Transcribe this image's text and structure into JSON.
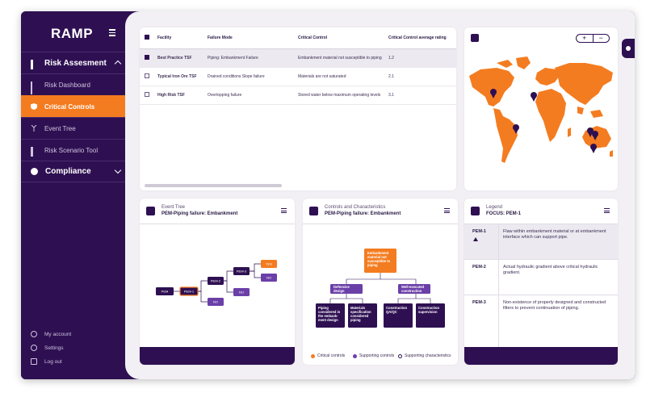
{
  "app": {
    "logo": "RAMP"
  },
  "sidebar": {
    "groups": [
      {
        "label": "Risk Assesment"
      },
      {
        "label": "Compliance"
      }
    ],
    "items": [
      {
        "label": "Risk Dashboard"
      },
      {
        "label": "Critical Controls"
      },
      {
        "label": "Event Tree"
      },
      {
        "label": "Risk Scenario Tool"
      }
    ],
    "footer": [
      {
        "label": "My account"
      },
      {
        "label": "Settings"
      },
      {
        "label": "Log out"
      }
    ]
  },
  "table": {
    "headers": [
      "Facility",
      "Failure Mode",
      "Critical Control",
      "Critical Control average rating"
    ],
    "rows": [
      {
        "facility": "Best Practice TSF",
        "mode": "Piping: Embankment Failure",
        "control": "Embankment material not susceptible to piping",
        "rating": "1.2",
        "checked": true
      },
      {
        "facility": "Typical Iron Ore TSF",
        "mode": "Drained conditions Slope failure",
        "control": "Materials are not saturated",
        "rating": "2.1",
        "checked": false
      },
      {
        "facility": "High Risk TSF",
        "mode": "Overtopping failure",
        "control": "Stored water below maximum operating levels",
        "rating": "3.1",
        "checked": false
      }
    ]
  },
  "map": {
    "zoom_in": "+",
    "zoom_out": "−",
    "land_color": "#f47c20",
    "pin_color": "#2e1052"
  },
  "event_tree": {
    "title": "Event Tree",
    "subtitle": "PEM-Piping failure: Embankment",
    "nodes": {
      "pem": "PEM",
      "pem1": "PEM-1",
      "pem2": "PEM-2",
      "pem3": "PEM-3",
      "pem4": "PEM-4",
      "yes": "YES",
      "no1": "NO",
      "no2": "NO",
      "no3": "NO"
    }
  },
  "controls": {
    "title": "Controls and Characteristics",
    "subtitle": "PEM-Piping failure: Embankment",
    "root": [
      "Embankment",
      "material not",
      "susceptible to",
      "piping"
    ],
    "mid_left": [
      "Defensive",
      "design"
    ],
    "mid_right": [
      "Well-executed",
      "construction"
    ],
    "leaves": [
      [
        "Piping",
        "considered in",
        "the embank-",
        "ment design"
      ],
      [
        "Materials",
        "specification",
        "considered",
        "piping"
      ],
      [
        "Construction",
        "QA/QC"
      ],
      [
        "Construction",
        "supervision"
      ]
    ],
    "keys": [
      "Critical controls",
      "Supporting controls",
      "Supporting characteristics"
    ],
    "key_colors": [
      "#f47c20",
      "#6b3fa8",
      "#ffffff"
    ]
  },
  "legend": {
    "title": "Legend",
    "subtitle": "FOCUS: PEM-1",
    "rows": [
      {
        "code": "PEM-1",
        "desc": "Flaw within embankment material or at embankment interface which can support pipe."
      },
      {
        "code": "PEM-2",
        "desc": "Actual hydraulic gradient above critical hydraulic gradient."
      },
      {
        "code": "PEM-3",
        "desc": "Non-existence of properly designed and constructed filters to prevent continuation of piping."
      }
    ]
  }
}
